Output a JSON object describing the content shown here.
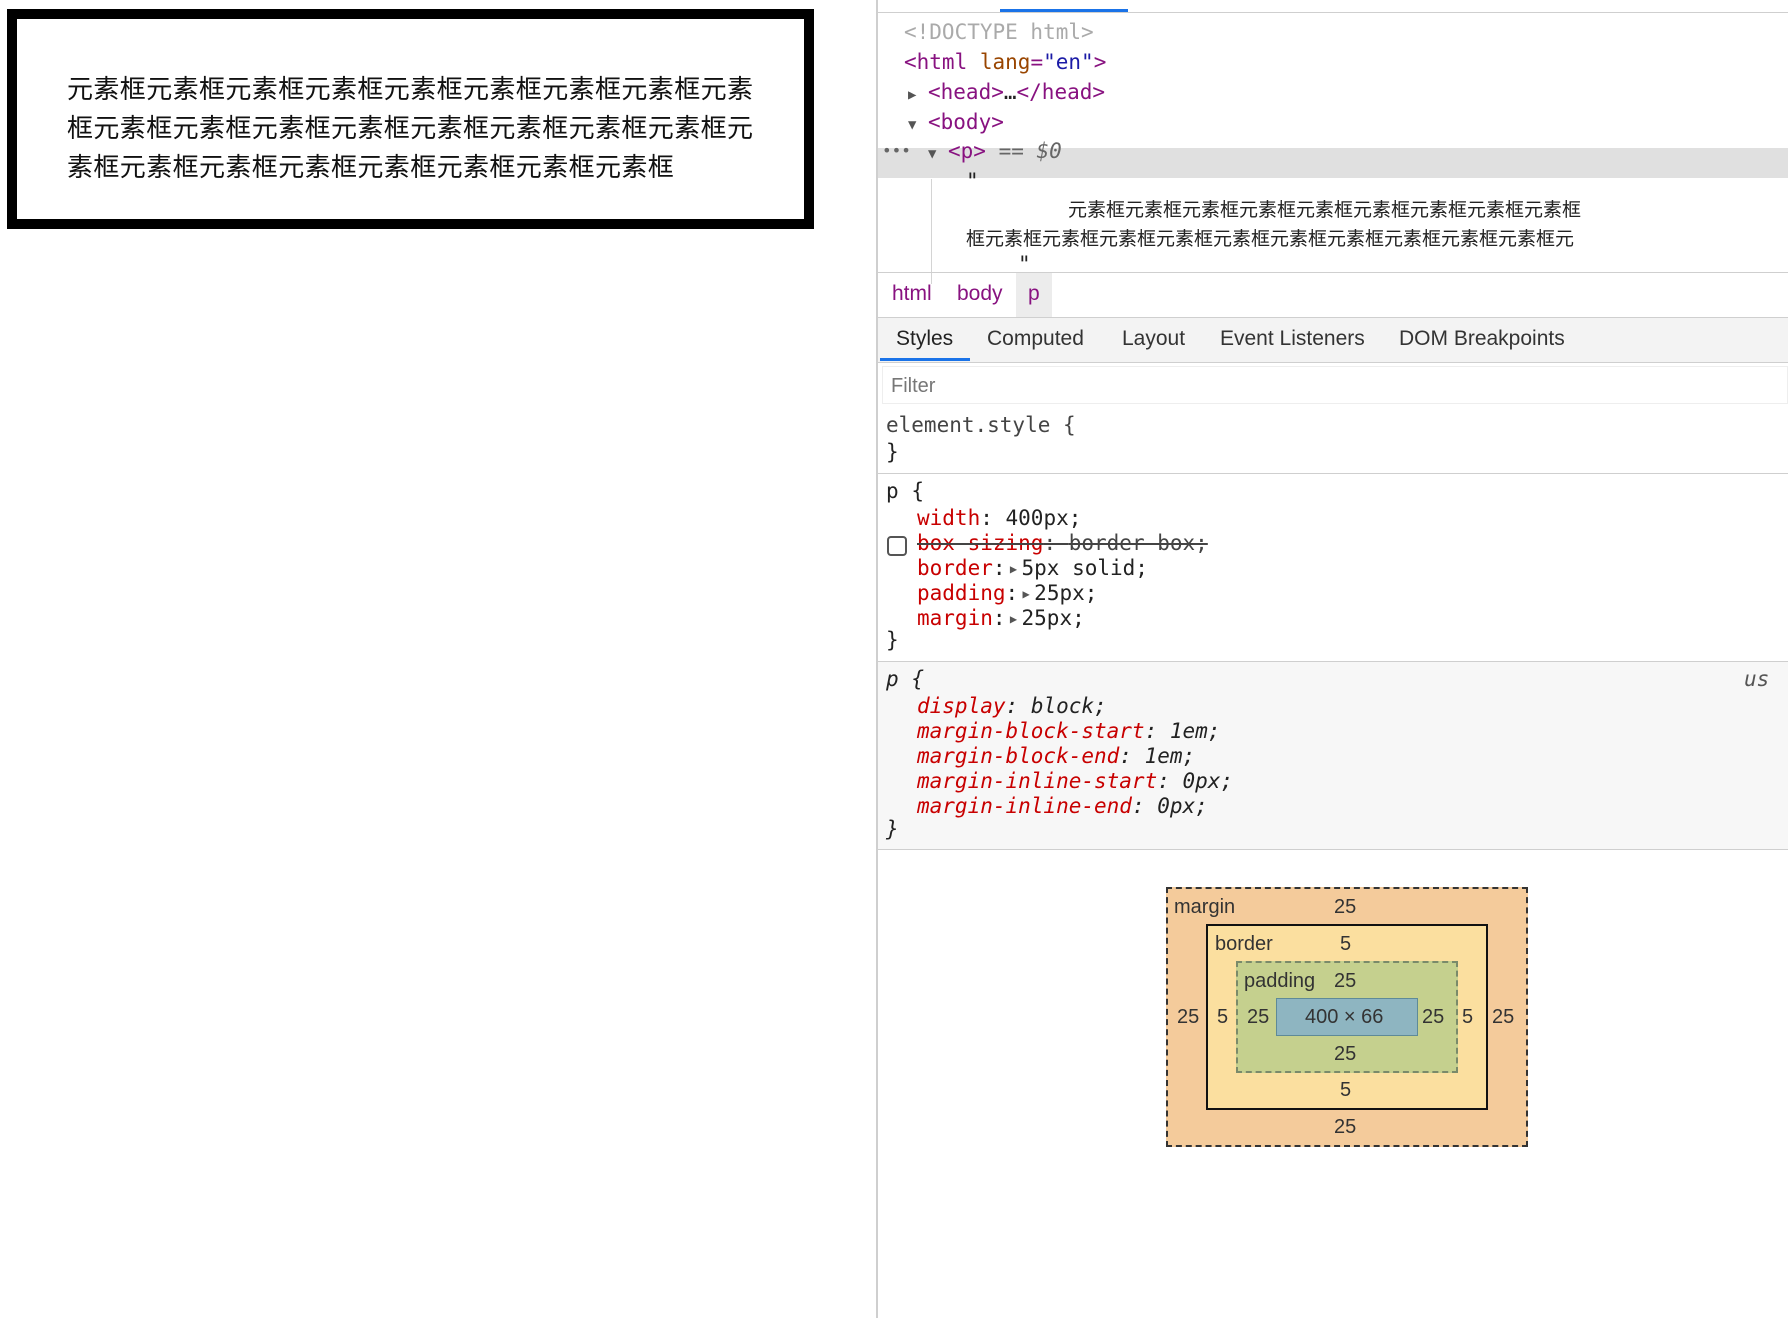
{
  "preview": {
    "paragraph_text": "元素框元素框元素框元素框元素框元素框元素框元素框元素框元素框元素框元素框元素框元素框元素框元素框元素框元素框元素框元素框元素框元素框元素框元素框元素框"
  },
  "elements": {
    "doctype": "<!DOCTYPE html>",
    "html_open_tag": "<html",
    "html_attr_name": "lang",
    "html_attr_value": "\"en\"",
    "html_open_close": ">",
    "head_open": "<head>",
    "head_ellipsis": "…",
    "head_close": "</head>",
    "body_open": "<body>",
    "p_open": "<p>",
    "selected_marker": "== $0",
    "dots": "•••",
    "quote": "\"",
    "text_line_1": "元素框元素框元素框元素框元素框元素框元素框元素框元素框",
    "text_line_2": "框元素框元素框元素框元素框元素框元素框元素框元素框元素框元素框元"
  },
  "breadcrumbs": [
    "html",
    "body",
    "p"
  ],
  "tabs": [
    "Styles",
    "Computed",
    "Layout",
    "Event Listeners",
    "DOM Breakpoints"
  ],
  "filter_placeholder": "Filter",
  "styles": {
    "element_style_selector": "element.style {",
    "close_brace": "}",
    "rule1_selector": "p",
    "open_brace": "{",
    "rule1_props": [
      {
        "name": "width",
        "value": "400px;"
      },
      {
        "name": "box-sizing",
        "value": "border-box;",
        "disabled": true
      },
      {
        "name": "border",
        "value": "5px solid;"
      },
      {
        "name": "padding",
        "value": "25px;"
      },
      {
        "name": "margin",
        "value": "25px;"
      }
    ],
    "rule2_selector": "p",
    "rule2_source": "us",
    "rule2_props": [
      {
        "name": "display",
        "value": "block;"
      },
      {
        "name": "margin-block-start",
        "value": "1em;"
      },
      {
        "name": "margin-block-end",
        "value": "1em;"
      },
      {
        "name": "margin-inline-start",
        "value": "0px;"
      },
      {
        "name": "margin-inline-end",
        "value": "0px;"
      }
    ]
  },
  "box_model": {
    "margin_label": "margin",
    "border_label": "border",
    "padding_label": "padding",
    "margin": {
      "top": "25",
      "right": "25",
      "bottom": "25",
      "left": "25"
    },
    "border": {
      "top": "5",
      "right": "5",
      "bottom": "5",
      "left": "5"
    },
    "padding": {
      "top": "25",
      "right": "25",
      "bottom": "25",
      "left": "25"
    },
    "content": "400 × 66"
  },
  "colors": {
    "accent": "#1a73e8",
    "tag": "#881280",
    "property": "#c80000",
    "margin_box": "#f4cb9b",
    "border_box": "#fbdf9f",
    "padding_box": "#c5d08e",
    "content_box": "#8eb5c1"
  }
}
